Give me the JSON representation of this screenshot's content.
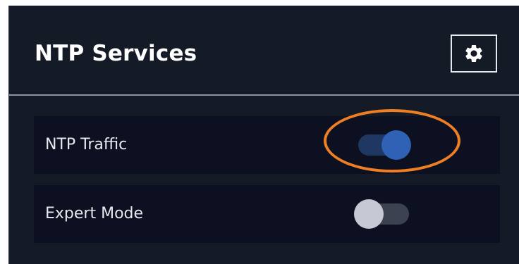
{
  "panel": {
    "title": "NTP Services",
    "settings_icon": "gear-icon"
  },
  "settings": [
    {
      "label": "NTP Traffic",
      "enabled": true
    },
    {
      "label": "Expert Mode",
      "enabled": false
    }
  ],
  "colors": {
    "panel_bg": "#141a26",
    "row_bg": "#0c1020",
    "toggle_on_track": "#1f3763",
    "toggle_on_knob": "#2f62b5",
    "toggle_off_track": "#3d4250",
    "toggle_off_knob": "#c6c9d3",
    "annotation": "#ef7f22"
  }
}
